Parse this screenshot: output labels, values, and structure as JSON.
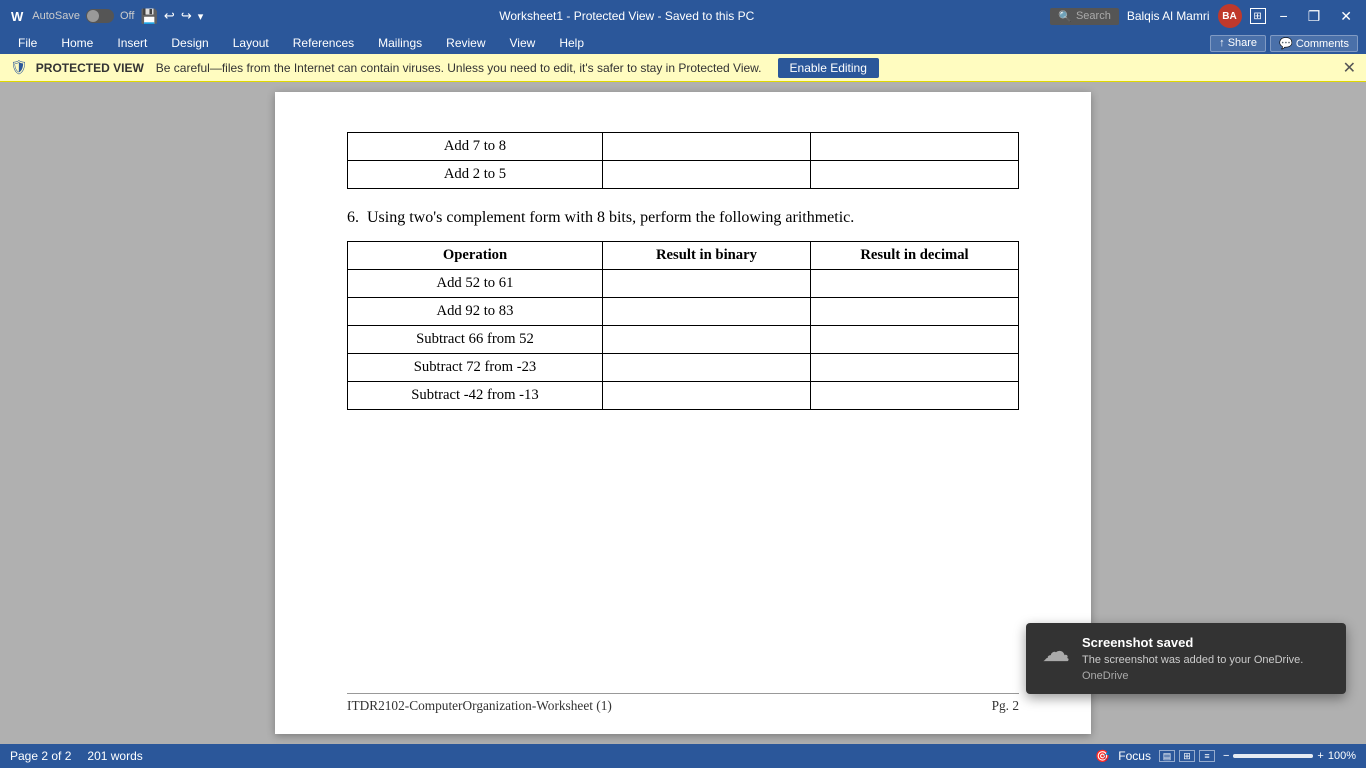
{
  "titleBar": {
    "autosave_label": "AutoSave",
    "autosave_state": "Off",
    "title": "Worksheet1 - Protected View - Saved to this PC",
    "search_placeholder": "Search",
    "user_name": "Balqis Al Mamri",
    "user_initials": "BA",
    "undo_label": "Undo",
    "redo_label": "Redo",
    "minimize_label": "−",
    "restore_label": "❐",
    "close_label": "✕"
  },
  "ribbon": {
    "tabs": [
      {
        "label": "File"
      },
      {
        "label": "Home"
      },
      {
        "label": "Insert"
      },
      {
        "label": "Design"
      },
      {
        "label": "Layout"
      },
      {
        "label": "References"
      },
      {
        "label": "Mailings"
      },
      {
        "label": "Review"
      },
      {
        "label": "View"
      },
      {
        "label": "Help"
      }
    ],
    "share_label": "Share",
    "comments_label": "Comments"
  },
  "protectedView": {
    "label": "PROTECTED VIEW",
    "message": "Be careful—files from the Internet can contain viruses. Unless you need to edit, it's safer to stay in Protected View.",
    "enable_editing_label": "Enable Editing",
    "close_label": "✕"
  },
  "document": {
    "prev_table": {
      "rows": [
        {
          "operation": "Add 7 to 8"
        },
        {
          "operation": "Add 2 to 5"
        }
      ]
    },
    "question6": {
      "number": "6.",
      "text": "Using two's complement form with 8 bits, perform the following arithmetic.",
      "table": {
        "headers": [
          "Operation",
          "Result in binary",
          "Result in decimal"
        ],
        "rows": [
          {
            "operation": "Add 52 to 61"
          },
          {
            "operation": "Add 92 to 83"
          },
          {
            "operation": "Subtract 66 from 52"
          },
          {
            "operation": "Subtract 72 from -23"
          },
          {
            "operation": "Subtract -42 from -13"
          }
        ]
      }
    },
    "footer": {
      "filename": "ITDR2102-ComputerOrganization-Worksheet (1)",
      "page": "Pg. 2"
    }
  },
  "statusBar": {
    "page_info": "Page 2 of 2",
    "word_count": "201 words",
    "focus_label": "Focus",
    "zoom_percent": "100%"
  },
  "notification": {
    "title": "Screenshot saved",
    "body": "The screenshot was added to your OneDrive.",
    "link": "OneDrive"
  }
}
